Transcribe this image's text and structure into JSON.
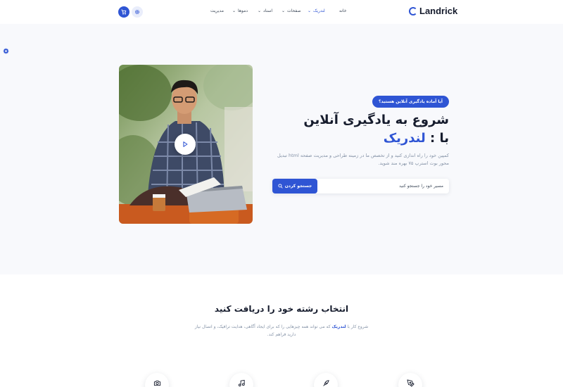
{
  "header": {
    "logo_text": "Landrick",
    "nav": [
      {
        "label": "خانه"
      },
      {
        "label": "لندریک"
      },
      {
        "label": "صفحات"
      },
      {
        "label": "اسناد"
      },
      {
        "label": "دموها"
      },
      {
        "label": "مدیریت"
      }
    ],
    "cart_icon": "cart-icon",
    "settings_icon": "gear-icon"
  },
  "hero": {
    "badge": "آیا آماده یادگیری آنلاین هستید؟",
    "title_line1": "شروع به یادگیری آنلاین",
    "title_line2_prefix": "با : ",
    "title_line2_brand": "لندریک",
    "lead": "کمپین خود را راه اندازی کنید و از تخصص ما در زمینه طراحی و مدیریت صفحه html تبدیل محور بوت استرپ ۷۵ بهره مند شوید.",
    "search": {
      "placeholder": "مسیر خود را جستجو کنید",
      "button_label": "جستجو کردن"
    },
    "play_icon": "play-icon",
    "colors": {
      "accent": "#2f55d4",
      "hero_bg": "#f8f9fc"
    }
  },
  "section": {
    "title": "انتخاب رشته خود را دریافت کنید",
    "desc_before": "شروع کار با ",
    "desc_brand": "لندریک",
    "desc_after": " که می تواند همه چیزهایی را که برای ایجاد آگاهی، هدایت ترافیک، و اتصال نیاز دارید فراهم کند."
  },
  "features": [
    {
      "icon": "camera-icon"
    },
    {
      "icon": "music-icon"
    },
    {
      "icon": "feather-icon"
    },
    {
      "icon": "pen-tool-icon"
    }
  ]
}
